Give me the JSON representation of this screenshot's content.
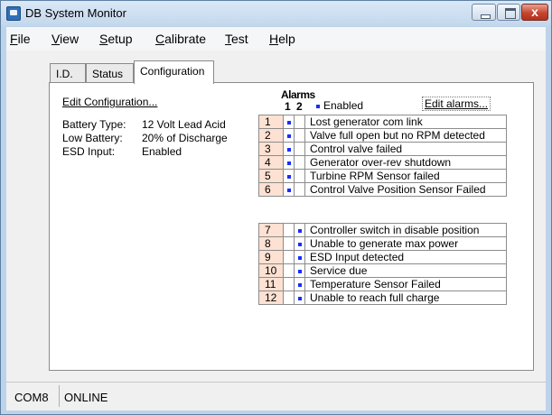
{
  "window": {
    "title": "DB System Monitor",
    "close_glyph": "x"
  },
  "menu": {
    "items": [
      {
        "underline": "F",
        "rest": "ile"
      },
      {
        "underline": "V",
        "rest": "iew"
      },
      {
        "underline": "S",
        "rest": "etup"
      },
      {
        "underline": "C",
        "rest": "alibrate"
      },
      {
        "underline": "T",
        "rest": "est"
      },
      {
        "underline": "H",
        "rest": "elp"
      }
    ]
  },
  "tabs": [
    {
      "label": "I.D.",
      "active": false
    },
    {
      "label": "Status",
      "active": false
    },
    {
      "label": "Configuration",
      "active": true
    }
  ],
  "configuration": {
    "edit_link": "Edit Configuration...",
    "fields": [
      {
        "label": "Battery Type:",
        "value": "12 Volt Lead Acid"
      },
      {
        "label": "Low Battery:",
        "value": "20% of Discharge"
      },
      {
        "label": "ESD Input:",
        "value": "Enabled"
      }
    ]
  },
  "alarms": {
    "title": "Alarms",
    "col1": "1",
    "col2": "2",
    "legend": "Enabled",
    "edit_link": "Edit alarms...",
    "group1": [
      {
        "num": "1",
        "c1": true,
        "c2": false,
        "desc": "Lost generator com link"
      },
      {
        "num": "2",
        "c1": true,
        "c2": false,
        "desc": "Valve full open but no RPM detected"
      },
      {
        "num": "3",
        "c1": true,
        "c2": false,
        "desc": "Control valve failed"
      },
      {
        "num": "4",
        "c1": true,
        "c2": false,
        "desc": "Generator over-rev shutdown"
      },
      {
        "num": "5",
        "c1": true,
        "c2": false,
        "desc": "Turbine RPM Sensor failed"
      },
      {
        "num": "6",
        "c1": true,
        "c2": false,
        "desc": "Control Valve Position Sensor Failed"
      }
    ],
    "group2": [
      {
        "num": "7",
        "c1": false,
        "c2": true,
        "desc": "Controller switch in disable position"
      },
      {
        "num": "8",
        "c1": false,
        "c2": true,
        "desc": "Unable to generate max power"
      },
      {
        "num": "9",
        "c1": false,
        "c2": true,
        "desc": "ESD Input detected"
      },
      {
        "num": "10",
        "c1": false,
        "c2": true,
        "desc": "Service due"
      },
      {
        "num": "11",
        "c1": false,
        "c2": true,
        "desc": "Temperature Sensor Failed"
      },
      {
        "num": "12",
        "c1": false,
        "c2": true,
        "desc": "Unable to reach full charge"
      }
    ]
  },
  "statusbar": {
    "port": "COM8",
    "state": "ONLINE"
  },
  "colors": {
    "enabled_marker": "#1a2cff",
    "alarm_number_bg": "#fde1d2",
    "link": "#0000e0"
  }
}
